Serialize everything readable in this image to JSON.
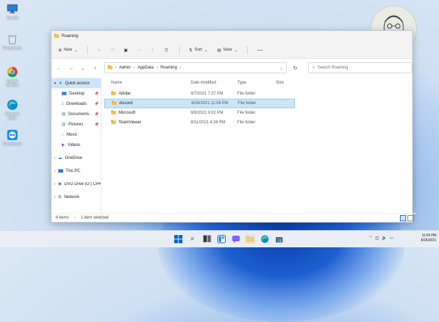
{
  "desktop": {
    "icons": [
      {
        "label": "This PC",
        "icon": "monitor-icon"
      },
      {
        "label": "Recycle Bin",
        "icon": "recycle-bin-icon"
      },
      {
        "label": "Google Chrome",
        "icon": "chrome-icon"
      },
      {
        "label": "Microsoft Edge",
        "icon": "edge-icon"
      },
      {
        "label": "TeamViewer",
        "icon": "teamviewer-icon"
      }
    ]
  },
  "window": {
    "title": "Roaming",
    "toolbar": {
      "new_label": "New",
      "sort_label": "Sort",
      "view_label": "View",
      "more_label": "···"
    },
    "address": {
      "crumbs": [
        "Admin",
        "AppData",
        "Roaming"
      ]
    },
    "search": {
      "placeholder": "Search Roaming"
    },
    "sidebar": {
      "quick_access": "Quick access",
      "pinned": [
        {
          "label": "Desktop",
          "icon": "desktop-folder-icon"
        },
        {
          "label": "Downloads",
          "icon": "downloads-icon"
        },
        {
          "label": "Documents",
          "icon": "documents-icon"
        },
        {
          "label": "Pictures",
          "icon": "pictures-icon"
        },
        {
          "label": "Music",
          "icon": "music-icon"
        },
        {
          "label": "Videos",
          "icon": "videos-icon"
        }
      ],
      "roots": [
        {
          "label": "OneDrive",
          "icon": "cloud-icon"
        },
        {
          "label": "This PC",
          "icon": "monitor-icon"
        },
        {
          "label": "DVD Drive (D:) CPRA",
          "icon": "dvd-icon"
        },
        {
          "label": "Network",
          "icon": "network-icon"
        }
      ]
    },
    "columns": {
      "name": "Name",
      "date": "Date modified",
      "type": "Type",
      "size": "Size"
    },
    "files": [
      {
        "name": "Adobe",
        "date": "8/7/2021 7:37 PM",
        "type": "File folder",
        "selected": false
      },
      {
        "name": "discord",
        "date": "8/26/2021 11:08 PM",
        "type": "File folder",
        "selected": true
      },
      {
        "name": "Microsoft",
        "date": "8/8/2021 9:02 PM",
        "type": "File folder",
        "selected": false
      },
      {
        "name": "TeamViewer",
        "date": "8/11/2021 4:28 PM",
        "type": "File folder",
        "selected": false
      }
    ],
    "status": {
      "items": "4 items",
      "selected": "1 item selected"
    }
  },
  "taskbar": {
    "time": "11:09 PM",
    "date": "8/26/2021",
    "colors": {
      "accent": "#0067c0",
      "selection": "#cce4f7"
    }
  }
}
